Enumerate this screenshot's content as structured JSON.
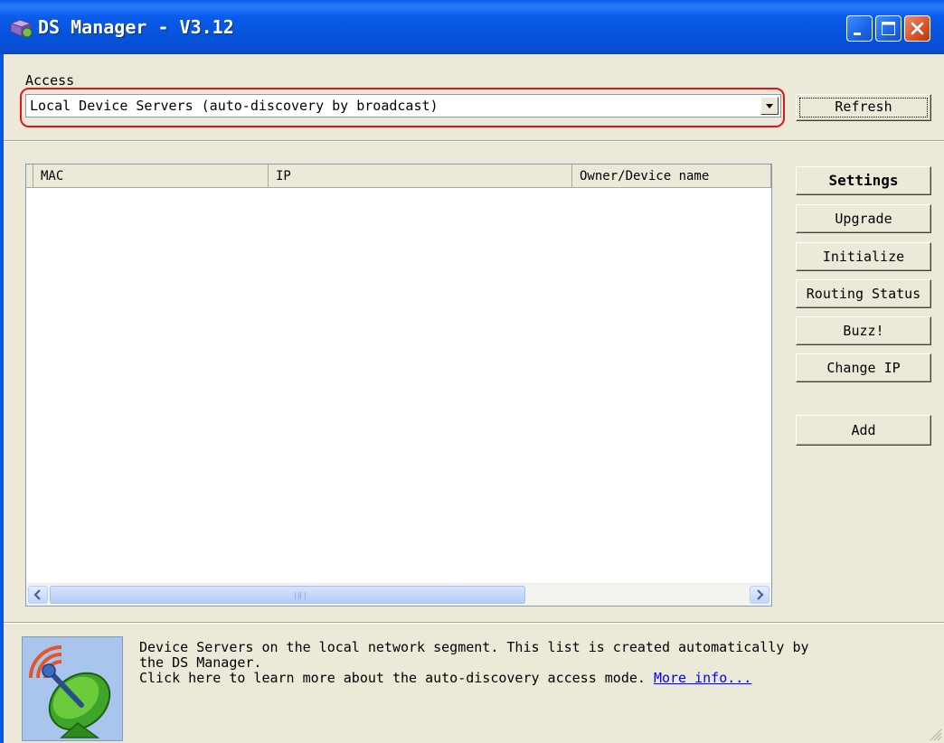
{
  "window": {
    "title": "DS Manager - V3.12"
  },
  "access": {
    "label": "Access",
    "selected": "Local Device Servers (auto-discovery by broadcast)",
    "refresh_label": "Refresh"
  },
  "list": {
    "columns": [
      "MAC",
      "IP",
      "Owner/Device name"
    ],
    "rows": []
  },
  "actions": {
    "settings": "Settings",
    "upgrade": "Upgrade",
    "initialize": "Initialize",
    "routing_status": "Routing Status",
    "buzz": "Buzz!",
    "change_ip": "Change IP",
    "add": "Add"
  },
  "info": {
    "line1": "Device Servers on the local network segment. This list is created automatically by",
    "line2": "the DS Manager.",
    "line3": "Click here to learn more about the auto-discovery access mode. ",
    "link": "More info..."
  },
  "colors": {
    "titlebar": "#0A54E3",
    "client": "#ECE9D8",
    "highlight": "#E3141B",
    "link": "#0000FF"
  }
}
